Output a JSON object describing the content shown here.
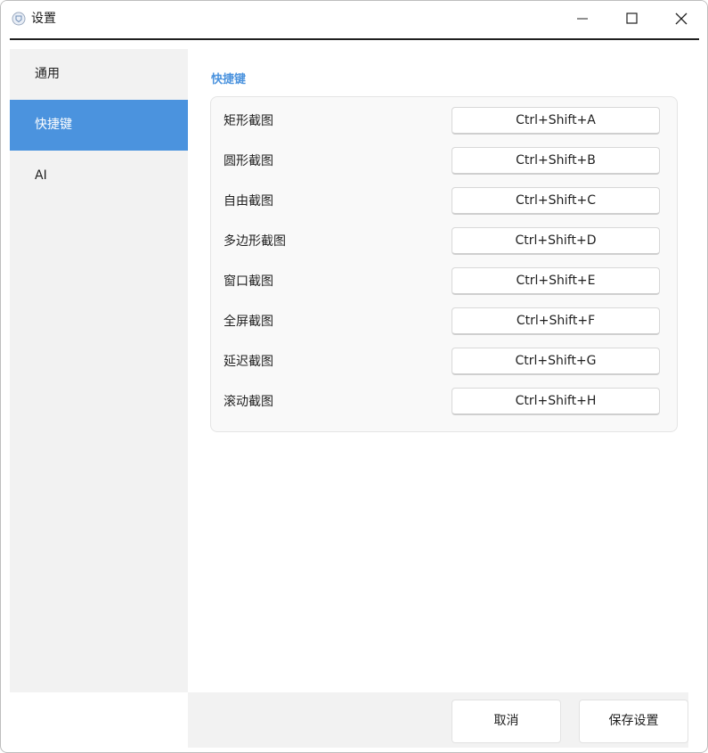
{
  "window": {
    "title": "设置"
  },
  "sidebar": {
    "items": [
      {
        "label": "通用",
        "active": false
      },
      {
        "label": "快捷键",
        "active": true
      },
      {
        "label": "AI",
        "active": false
      }
    ]
  },
  "main": {
    "section_title": "快捷键",
    "shortcuts": [
      {
        "label": "矩形截图",
        "value": "Ctrl+Shift+A"
      },
      {
        "label": "圆形截图",
        "value": "Ctrl+Shift+B"
      },
      {
        "label": "自由截图",
        "value": "Ctrl+Shift+C"
      },
      {
        "label": "多边形截图",
        "value": "Ctrl+Shift+D"
      },
      {
        "label": "窗口截图",
        "value": "Ctrl+Shift+E"
      },
      {
        "label": "全屏截图",
        "value": "Ctrl+Shift+F"
      },
      {
        "label": "延迟截图",
        "value": "Ctrl+Shift+G"
      },
      {
        "label": "滚动截图",
        "value": "Ctrl+Shift+H"
      }
    ]
  },
  "footer": {
    "cancel_label": "取消",
    "save_label": "保存设置"
  },
  "colors": {
    "accent": "#4b93de",
    "sidebar_bg": "#f2f2f2",
    "card_bg": "#f9f9f9"
  },
  "icons": {
    "app": "app-icon",
    "minimize": "minimize-icon",
    "maximize": "maximize-icon",
    "close": "close-icon"
  }
}
